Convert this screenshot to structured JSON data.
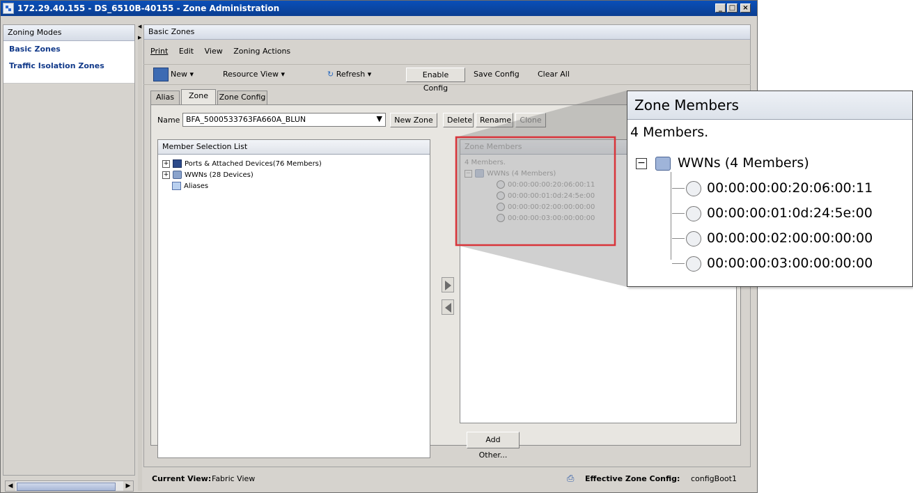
{
  "window": {
    "title": "172.29.40.155 - DS_6510B-40155 - Zone Administration",
    "controls": [
      "_",
      "□",
      "×"
    ]
  },
  "left_panel": {
    "header": "Zoning Modes",
    "items": [
      {
        "label": "Basic Zones"
      },
      {
        "label": "Traffic Isolation Zones"
      }
    ]
  },
  "main": {
    "header": "Basic Zones",
    "menu": {
      "print": "Print",
      "edit": "Edit",
      "view": "View",
      "zoning_actions": "Zoning Actions"
    },
    "toolbar": {
      "new": "New",
      "resource_view": "Resource View",
      "refresh": "Refresh",
      "enable_config": "Enable Config",
      "save_config": "Save Config",
      "clear_all": "Clear All"
    },
    "tabs": [
      {
        "label": "Alias",
        "active": false
      },
      {
        "label": "Zone",
        "active": true
      },
      {
        "label": "Zone Config",
        "active": false
      }
    ],
    "name_row": {
      "label": "Name",
      "value": "BFA_5000533763FA660A_BLUN",
      "new_zone": "New Zone",
      "delete": "Delete",
      "rename": "Rename",
      "clone": "Clone"
    },
    "member_selection": {
      "title": "Member Selection List",
      "rows": [
        {
          "label": "Ports & Attached Devices(76 Members)",
          "icon": "ports-icon"
        },
        {
          "label": "WWNs (28 Devices)",
          "icon": "wwn-icon"
        },
        {
          "label": "Aliases",
          "icon": "alias-icon"
        }
      ]
    },
    "zone_members": {
      "title": "Zone Members",
      "count": "4 Members.",
      "group": "WWNs (4 Members)",
      "members": [
        "00:00:00:00:20:06:00:11",
        "00:00:00:01:0d:24:5e:00",
        "00:00:00:02:00:00:00:00",
        "00:00:00:03:00:00:00:00"
      ],
      "add_other": "Add Other..."
    }
  },
  "status": {
    "current_view_label": "Current View:",
    "current_view_value": "Fabric View",
    "effective_label": "Effective Zone Config:",
    "effective_value": "configBoot1"
  },
  "zoom_callout": {
    "title": "Zone Members",
    "count": "4 Members.",
    "group": "WWNs (4 Members)",
    "members": [
      "00:00:00:00:20:06:00:11",
      "00:00:00:01:0d:24:5e:00",
      "00:00:00:02:00:00:00:00",
      "00:00:00:03:00:00:00:00"
    ]
  },
  "colors": {
    "titlebar": "#0b3e91",
    "mode_text": "#123a8a",
    "highlight_box": "#d9343a"
  }
}
